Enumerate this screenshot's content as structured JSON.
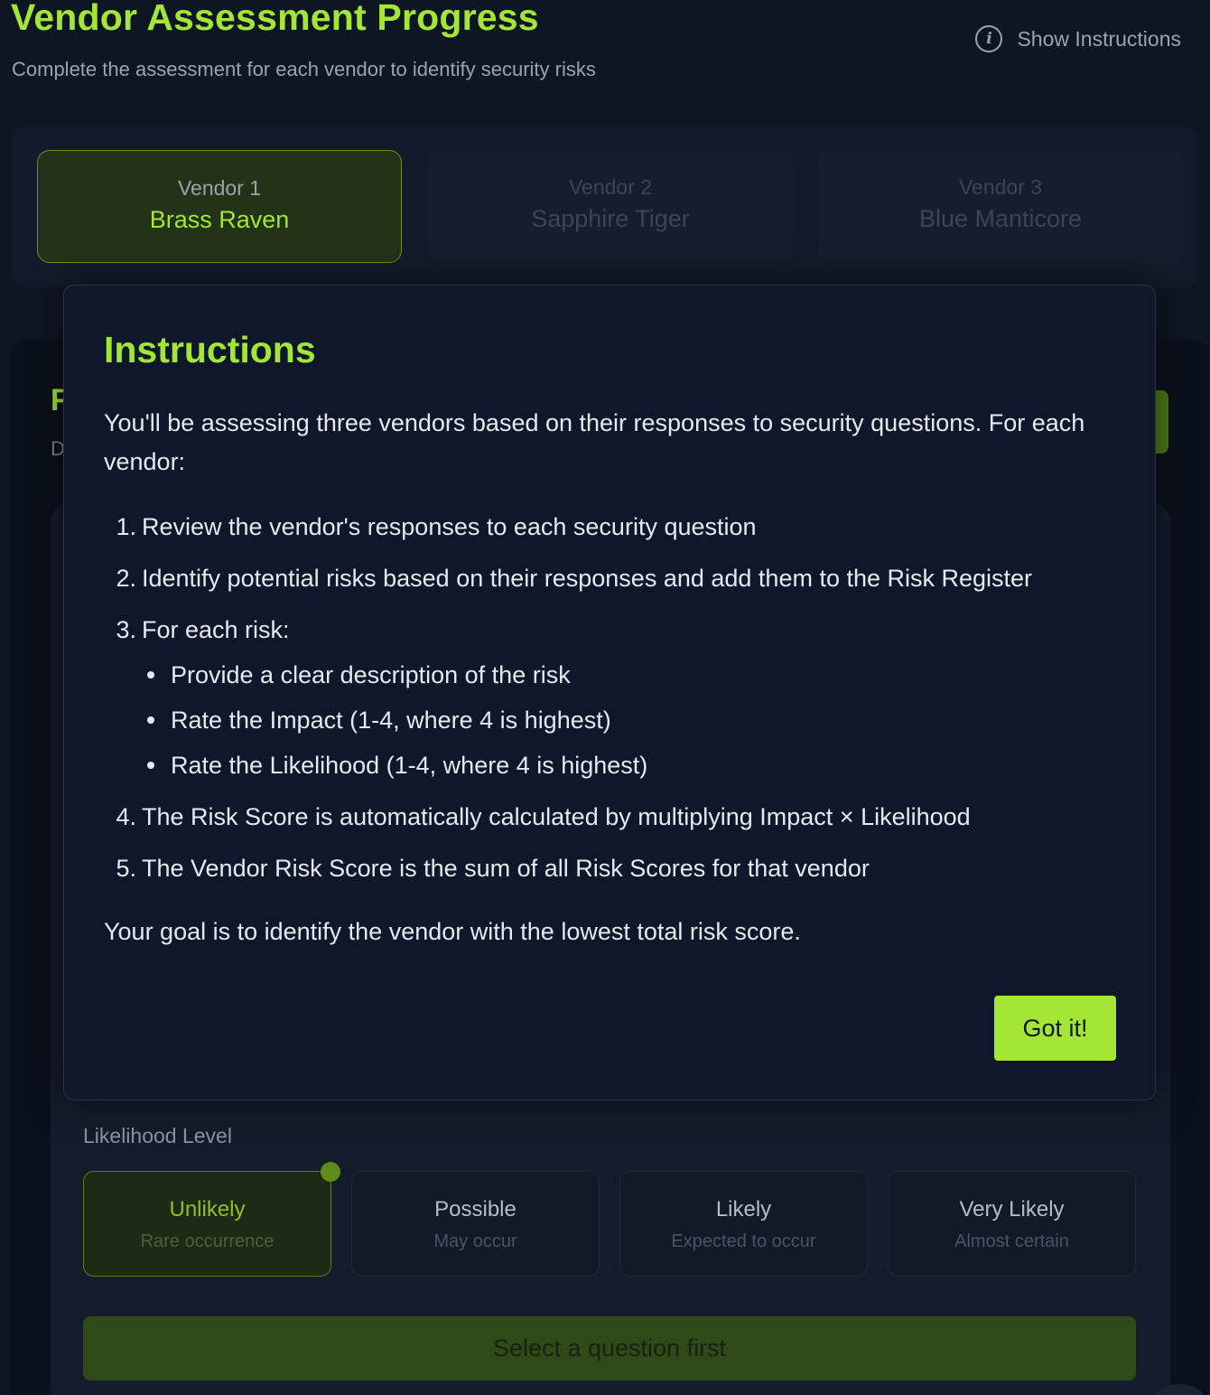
{
  "header": {
    "title": "Vendor Assessment Progress",
    "subtitle": "Complete the assessment for each vendor to identify security risks",
    "show_instructions_label": "Show Instructions"
  },
  "vendors": [
    {
      "label": "Vendor 1",
      "name": "Brass Raven",
      "active": true
    },
    {
      "label": "Vendor 2",
      "name": "Sapphire Tiger",
      "active": false
    },
    {
      "label": "Vendor 3",
      "name": "Blue Manticore",
      "active": false
    }
  ],
  "background_fragments": {
    "letter_f": "F",
    "letter_d": "D"
  },
  "likelihood": {
    "label": "Likelihood Level",
    "options": [
      {
        "title": "Unlikely",
        "subtitle": "Rare occurrence",
        "selected": true
      },
      {
        "title": "Possible",
        "subtitle": "May occur",
        "selected": false
      },
      {
        "title": "Likely",
        "subtitle": "Expected to occur",
        "selected": false
      },
      {
        "title": "Very Likely",
        "subtitle": "Almost certain",
        "selected": false
      }
    ]
  },
  "submit_button_label": "Select a question first",
  "modal": {
    "title": "Instructions",
    "intro": "You'll be assessing three vendors based on their responses to security questions. For each vendor:",
    "steps": [
      {
        "num": "1.",
        "text": "Review the vendor's responses to each security question"
      },
      {
        "num": "2.",
        "text": "Identify potential risks based on their responses and add them to the Risk Register"
      },
      {
        "num": "3.",
        "text": "For each risk:"
      },
      {
        "num": "4.",
        "text": "The Risk Score is automatically calculated by multiplying Impact × Likelihood"
      },
      {
        "num": "5.",
        "text": "The Vendor Risk Score is the sum of all Risk Scores for that vendor"
      }
    ],
    "substeps": [
      "Provide a clear description of the risk",
      "Rate the Impact (1-4, where 4 is highest)",
      "Rate the Likelihood (1-4, where 4 is highest)"
    ],
    "goal": "Your goal is to identify the vendor with the lowest total risk score.",
    "confirm_label": "Got it!"
  },
  "colors": {
    "accent": "#a3e635",
    "background": "#0f1623",
    "modal_bg": "#0f172a"
  },
  "icons": {
    "show_instructions": "info-icon"
  }
}
